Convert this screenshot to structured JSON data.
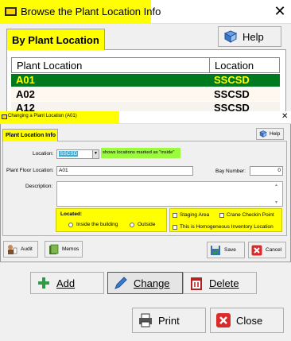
{
  "outer": {
    "title": "Browse the Plant Location Info",
    "tab": "By Plant Location",
    "help_label": "Help",
    "columns": [
      "Plant Location",
      "Location"
    ],
    "rows": [
      {
        "plant": "A01",
        "loc": "SSCSD"
      },
      {
        "plant": "A02",
        "loc": "SSCSD"
      },
      {
        "plant": "A12",
        "loc": "SSCSD"
      }
    ],
    "buttons": {
      "add": "Add",
      "change": "Change",
      "delete": "Delete",
      "print": "Print",
      "close": "Close"
    }
  },
  "inner": {
    "title": "Changing a Plant Location  (A01)",
    "tab": "Plant Location Info",
    "help_label": "Help",
    "location_label": "Location:",
    "location_value": "SSCSD",
    "location_hint": "shows locations marked as \"inside\"",
    "floor_label": "Plant Floor Location:",
    "floor_value": "A01",
    "bay_label": "Bay Number:",
    "bay_value": "0",
    "description_label": "Description:",
    "located_label": "Located:",
    "located_options": [
      "Inside the building",
      "Outside"
    ],
    "staging_label": "Staging Area",
    "crane_label": "Crane Checkin Point",
    "homogeneous_label": "This is Homogeneous Inventory Location",
    "audit_label": "Audit",
    "memos_label": "Memos",
    "save_label": "Save",
    "cancel_label": "Cancel"
  },
  "colors": {
    "highlight": "#ffff00",
    "selected_row": "#007a1f",
    "hint": "#9afc3c"
  }
}
